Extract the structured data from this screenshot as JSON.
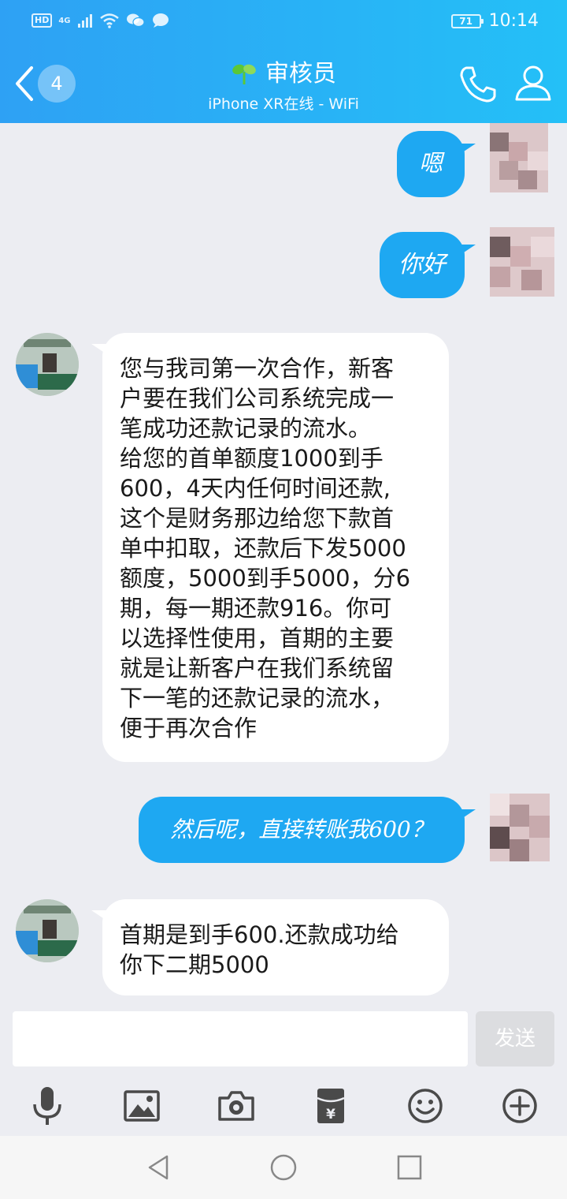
{
  "status_bar": {
    "hd": "HD",
    "network": "4G",
    "battery": "71",
    "time": "10:14"
  },
  "title_bar": {
    "badge": "4",
    "title": "审核员",
    "subtitle": "iPhone XR在线 - WiFi"
  },
  "messages": [
    {
      "direction": "out",
      "text": "嗯"
    },
    {
      "direction": "out",
      "text": "你好"
    },
    {
      "direction": "in",
      "lines": [
        "您与我司第一次合作，新客",
        "户要在我们公司系统完成一",
        "笔成功还款记录的流水。",
        "给您的首单额度1000到手",
        "600，4天内任何时间还款,",
        "这个是财务那边给您下款首",
        "单中扣取，还款后下发5000",
        "额度，5000到手5000，分6",
        "期，每一期还款916。你可",
        "以选择性使用，首期的主要",
        "就是让新客户在我们系统留",
        "下一笔的还款记录的流水，",
        "便于再次合作"
      ]
    },
    {
      "direction": "out",
      "text": "然后呢，直接转账我600？"
    },
    {
      "direction": "in",
      "lines": [
        "首期是到手600.还款成功给",
        "你下二期5000"
      ]
    }
  ],
  "input": {
    "value": "",
    "send_label": "发送"
  },
  "toolbar": [
    "mic-icon",
    "image-icon",
    "camera-icon",
    "red-packet-icon",
    "emoji-icon",
    "plus-icon"
  ],
  "colors": {
    "header_start": "#2ea1f4",
    "header_end": "#24c0f7",
    "bubble_out": "#1ea8f2",
    "chat_bg": "#ecedf2",
    "icon": "#4a4a4a"
  }
}
